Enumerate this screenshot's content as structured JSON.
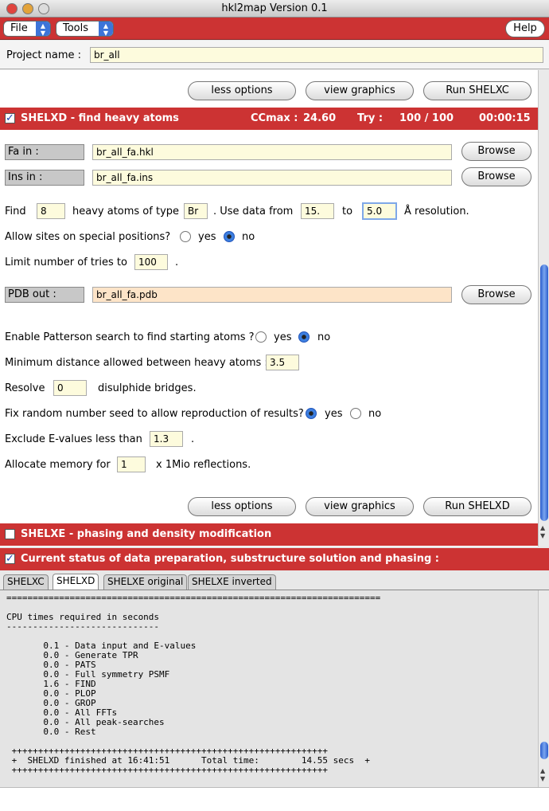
{
  "window": {
    "title": "hkl2map Version 0.1"
  },
  "menubar": {
    "file": "File",
    "tools": "Tools",
    "help": "Help"
  },
  "project": {
    "label": "Project name :",
    "value": "br_all"
  },
  "shelxc_actions": {
    "less": "less options",
    "graphics": "view graphics",
    "run": "Run SHELXC"
  },
  "shelxd": {
    "header": "SHELXD - find heavy atoms",
    "ccmax_label": "CCmax :",
    "ccmax_value": "24.60",
    "try_label": "Try :",
    "try_value": "100 / 100",
    "time": "00:00:15",
    "fa_label": "Fa in :",
    "fa_value": "br_all_fa.hkl",
    "ins_label": "Ins in :",
    "ins_value": "br_all_fa.ins",
    "browse": "Browse",
    "find_label": "Find",
    "find_value": "8",
    "heavy_label": "heavy atoms of type",
    "atom_type": "Br",
    "use_data_label": ". Use data from",
    "res_from": "15.",
    "to_label": "to",
    "res_to": "5.0",
    "resolution_label": "Å resolution.",
    "special_label": "Allow sites on special positions?",
    "yes": "yes",
    "no": "no",
    "limit_label": "Limit number of tries to",
    "limit_value": "100",
    "limit_suffix": ".",
    "pdb_label": "PDB out :",
    "pdb_value": "br_all_fa.pdb",
    "patterson_label": "Enable Patterson search to find starting atoms ?",
    "mindist_label": "Minimum distance allowed between heavy atoms :",
    "mindist_value": "3.5",
    "resolve_label": "Resolve",
    "resolve_value": "0",
    "disulphide_label": "disulphide bridges.",
    "seed_label": "Fix random number seed to allow reproduction of results?",
    "exclude_label": "Exclude E-values less than",
    "exclude_value": "1.3",
    "exclude_suffix": ".",
    "memory_label": "Allocate memory for",
    "memory_value": "1",
    "memory_suffix": "x 1Mio reflections.",
    "less": "less options",
    "graphics": "view graphics",
    "run": "Run SHELXD"
  },
  "shelxe": {
    "header": "SHELXE - phasing and density modification"
  },
  "status": {
    "header": "Current status of data preparation, substructure solution and phasing :"
  },
  "tabs": [
    "SHELXC",
    "SHELXD",
    "SHELXE original",
    "SHELXE inverted"
  ],
  "log": "=======================================================================\n\nCPU times required in seconds\n-----------------------------\n\n       0.1 - Data input and E-values\n       0.0 - Generate TPR\n       0.0 - PATS\n       0.0 - Full symmetry PSMF\n       1.6 - FIND\n       0.0 - PLOP\n       0.0 - GROP\n       0.0 - All FFTs\n       0.0 - All peak-searches\n       0.0 - Rest\n\n ++++++++++++++++++++++++++++++++++++++++++++++++++++++++++++\n +  SHELXD finished at 16:41:51      Total time:        14.55 secs  +\n ++++++++++++++++++++++++++++++++++++++++++++++++++++++++++++",
  "colors": {
    "accent_red": "#cc3333",
    "field_yellow": "#fdfbdd",
    "field_orange": "#fde4c8"
  }
}
